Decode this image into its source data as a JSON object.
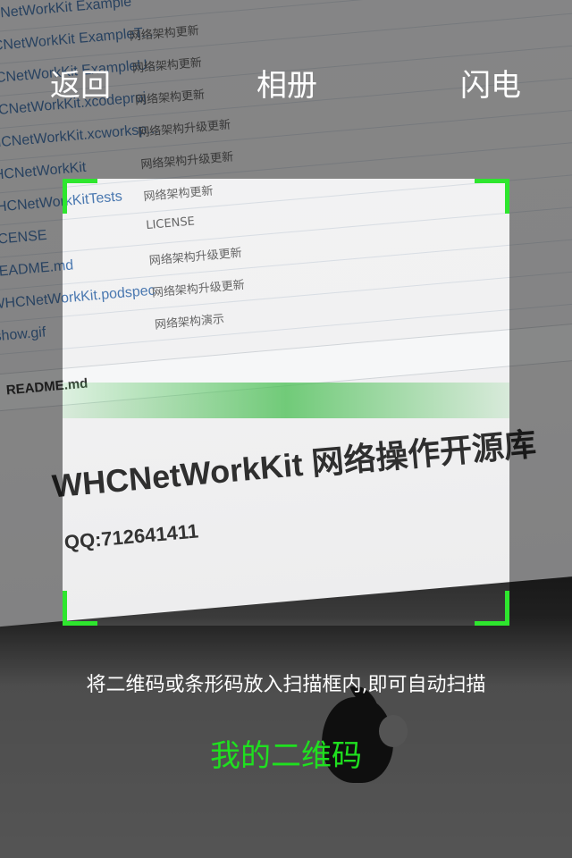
{
  "topbar": {
    "back_label": "返回",
    "album_label": "相册",
    "flash_label": "闪电"
  },
  "camera_view": {
    "file_rows": [
      {
        "name": "WHCNetWorkKit Example",
        "desc": ""
      },
      {
        "name": "WHCNetWorkKit ExampleT...",
        "desc": "网络架构更新"
      },
      {
        "name": "WHCNetWorkKit ExampleU...",
        "desc": "网络架构更新"
      },
      {
        "name": "WHCNetWorkKit.xcodeproj",
        "desc": "网络架构更新"
      },
      {
        "name": "WHCNetWorkKit.xcworksp...",
        "desc": "网络架构升级更新"
      },
      {
        "name": "WHCNetWorkKit",
        "desc": "网络架构升级更新"
      },
      {
        "name": "WHCNetWorkKitTests",
        "desc": "网络架构更新"
      },
      {
        "name": "LICENSE",
        "desc": "LICENSE"
      },
      {
        "name": "README.md",
        "desc": "网络架构升级更新"
      },
      {
        "name": "WHCNetWorkKit.podspec",
        "desc": "网络架构升级更新"
      },
      {
        "name": "show.gif",
        "desc": "网络架构演示"
      }
    ],
    "readme_label": "README.md",
    "repo_title": "WHCNetWorkKit 网络操作开源库",
    "repo_qq": "QQ:712641411"
  },
  "scanner": {
    "frame_color": "#2ee62e",
    "hint": "将二维码或条形码放入扫描框内,即可自动扫描"
  },
  "my_qr_label": "我的二维码",
  "colors": {
    "accent_green": "#1fe01f",
    "text_white": "#ffffff"
  }
}
